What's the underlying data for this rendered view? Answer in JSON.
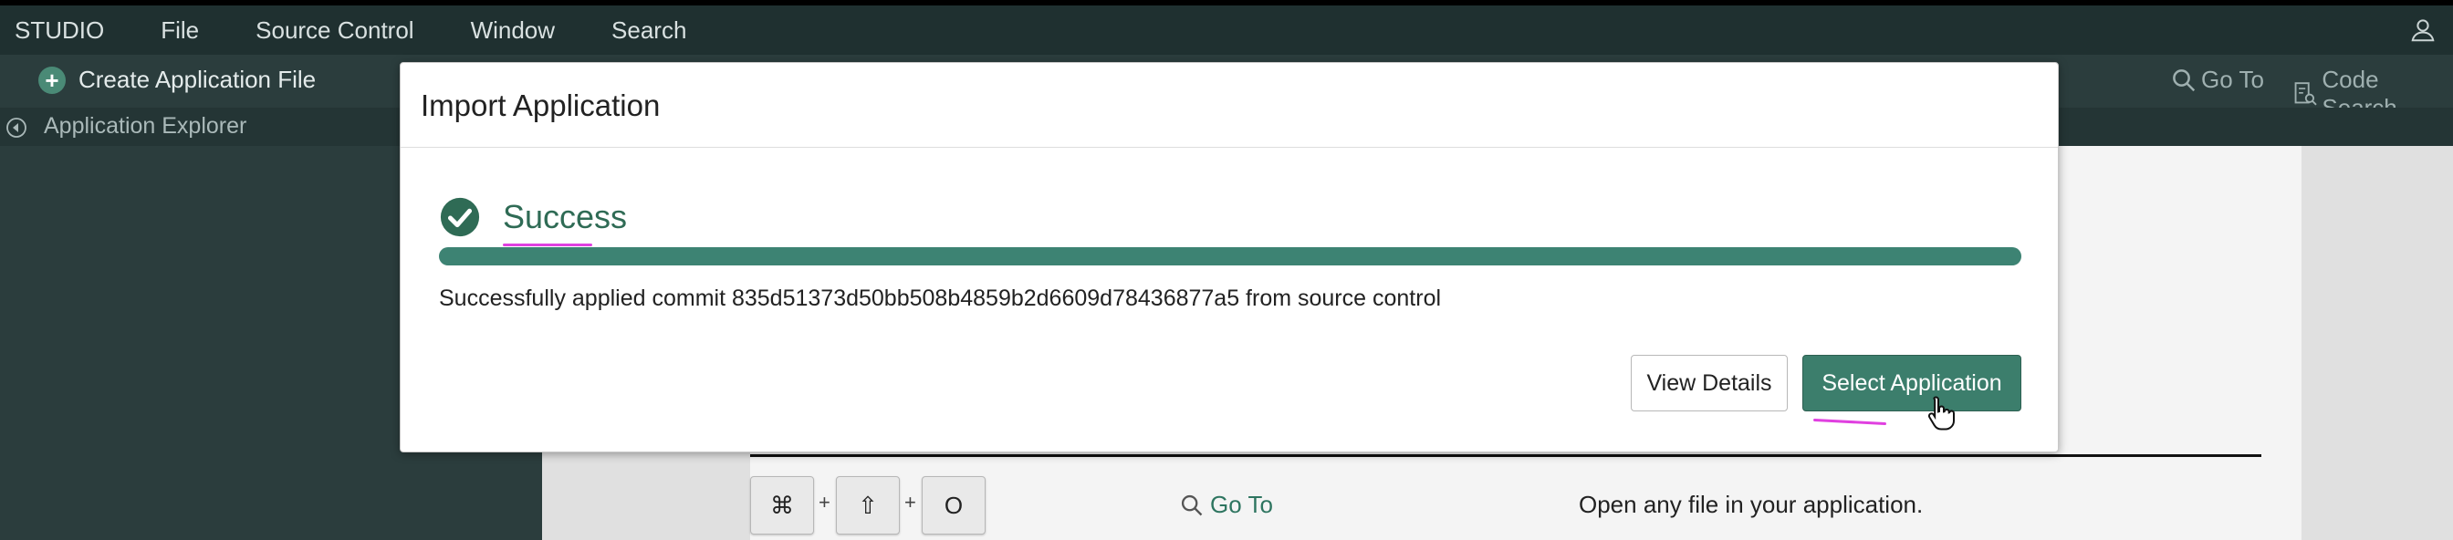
{
  "menubar": {
    "items": [
      "STUDIO",
      "File",
      "Source Control",
      "Window",
      "Search"
    ]
  },
  "toolbar": {
    "create_label": "Create Application File",
    "goto_label": "Go To",
    "code_search_label": "Code Search"
  },
  "explorer": {
    "title": "Application Explorer"
  },
  "shortcut_hint": {
    "keys": [
      "⌘",
      "⇧",
      "O"
    ],
    "separator": "+",
    "goto_label": "Go To",
    "description": "Open any file in your application."
  },
  "modal": {
    "title": "Import Application",
    "status": "Success",
    "progress_percent": 100,
    "message": "Successfully applied commit 835d51373d50bb508b4859b2d6609d78436877a5 from source control",
    "view_details_label": "View Details",
    "select_application_label": "Select Application"
  },
  "colors": {
    "accent": "#3c7e6c",
    "success": "#2f6b55",
    "annotation": "#e040e0"
  },
  "icons": [
    "plus-icon",
    "search-icon",
    "code-search-icon",
    "user-icon",
    "collapse-icon",
    "check-circle-icon",
    "pointer-cursor-icon"
  ]
}
